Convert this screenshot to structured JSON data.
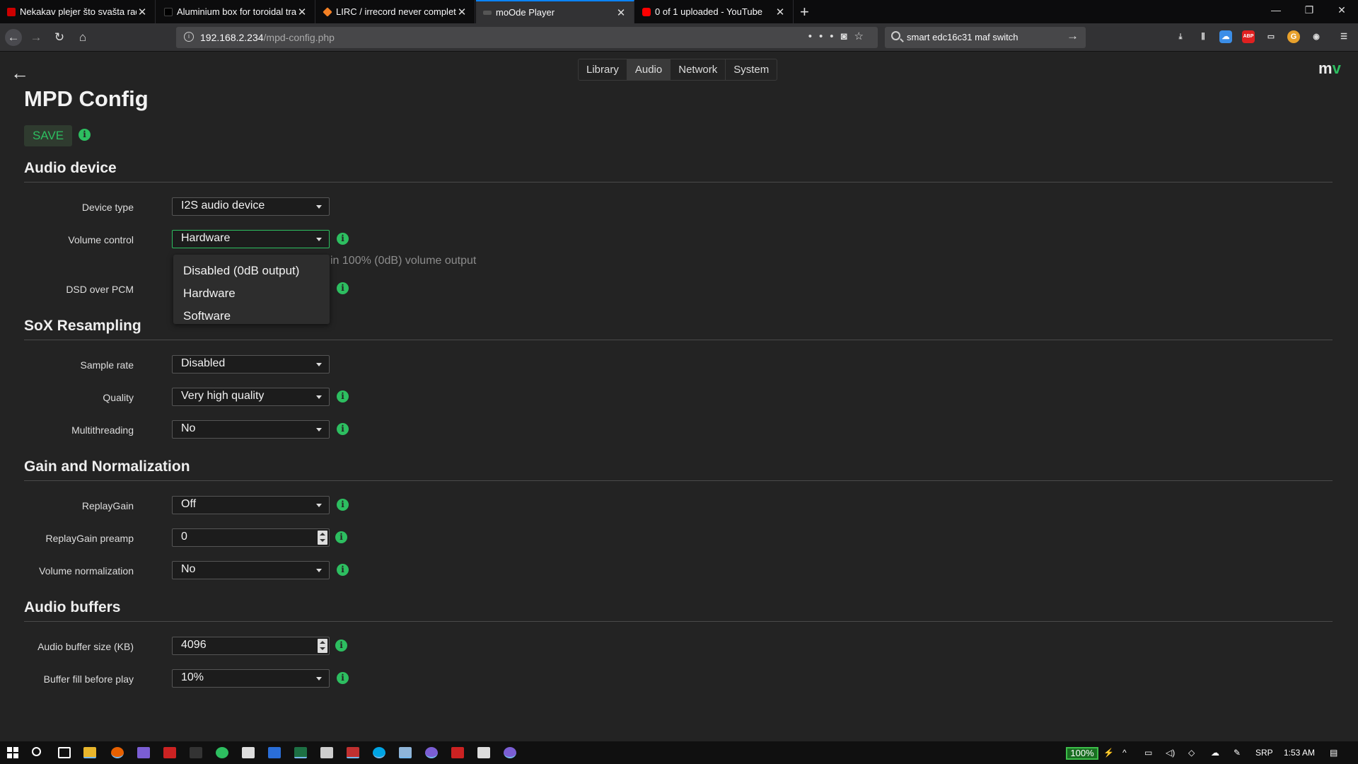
{
  "browser": {
    "tabs": [
      {
        "title": "Nekakav plejer što svašta radi -",
        "favicon_color": "#c00"
      },
      {
        "title": "Aluminium box for toroidal tra",
        "favicon_color": "#000"
      },
      {
        "title": "LIRC / irrecord never completes",
        "favicon_color": "#f48024"
      },
      {
        "title": "moOde Player",
        "favicon_color": "#555"
      },
      {
        "title": "0 of 1 uploaded - YouTube",
        "favicon_color": "#f00"
      }
    ],
    "url": {
      "host": "192.168.2.234",
      "path": "/mpd-config.php"
    },
    "search": {
      "text": "smart edc16c31 maf switch"
    },
    "icons": [
      "back-icon",
      "forward-icon",
      "reload-icon",
      "home-icon",
      "download-icon",
      "library-icon",
      "adblock-icon",
      "sidebar-icon",
      "menu-icon"
    ]
  },
  "nav": {
    "library": "Library",
    "audio": "Audio",
    "network": "Network",
    "system": "System"
  },
  "logo": {
    "m": "m",
    "v": "v"
  },
  "page": {
    "title": "MPD Config",
    "save": "SAVE"
  },
  "sections": {
    "audio_device": "Audio device",
    "sox": "SoX Resampling",
    "gain": "Gain and Normalization",
    "buffers": "Audio buffers"
  },
  "fields": {
    "device_type": {
      "label": "Device type",
      "value": "I2S audio device"
    },
    "volume_control": {
      "label": "Volume control",
      "value": "Hardware",
      "help": "in 100% (0dB) volume output"
    },
    "dsd_over_pcm": {
      "label": "DSD over PCM"
    },
    "sample_rate": {
      "label": "Sample rate",
      "value": "Disabled"
    },
    "quality": {
      "label": "Quality",
      "value": "Very high quality"
    },
    "multithreading": {
      "label": "Multithreading",
      "value": "No"
    },
    "replaygain": {
      "label": "ReplayGain",
      "value": "Off"
    },
    "replaygain_preamp": {
      "label": "ReplayGain preamp",
      "value": "0"
    },
    "volume_normalization": {
      "label": "Volume normalization",
      "value": "No"
    },
    "audio_buffer_size": {
      "label": "Audio buffer size (KB)",
      "value": "4096"
    },
    "buffer_fill": {
      "label": "Buffer fill before play",
      "value": "10%"
    }
  },
  "volume_dropdown": {
    "options": [
      "Disabled (0dB output)",
      "Hardware",
      "Software"
    ],
    "selected": "Hardware"
  },
  "taskbar": {
    "battery": "100%",
    "language": "SRP",
    "time": "1:53 AM"
  },
  "colors": {
    "accent": "#2dbe60",
    "background": "#232323"
  }
}
